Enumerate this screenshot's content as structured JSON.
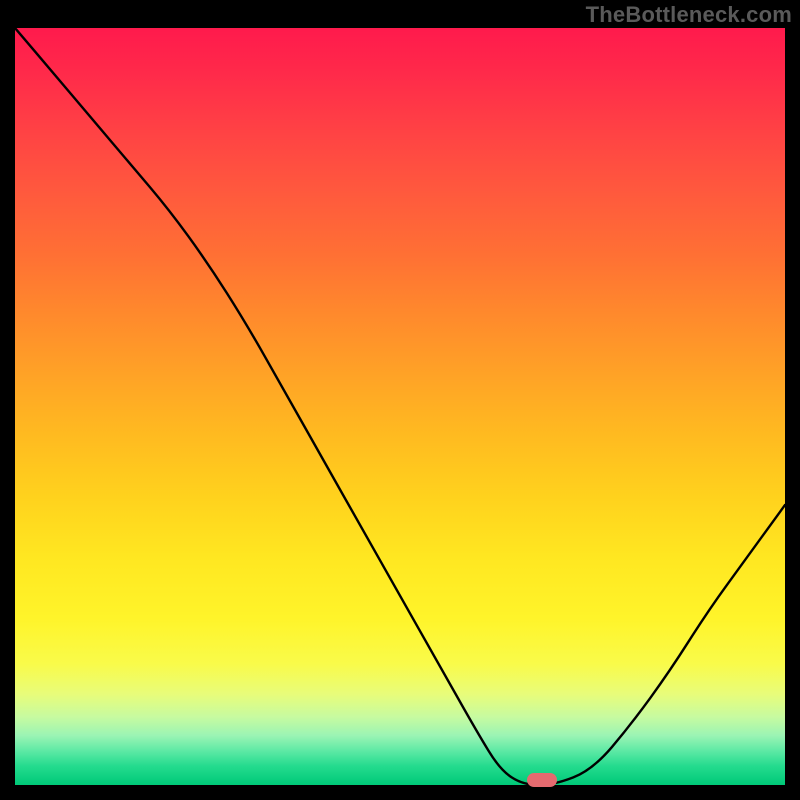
{
  "watermark": "TheBottleneck.com",
  "chart_data": {
    "type": "line",
    "title": "",
    "xlabel": "",
    "ylabel": "",
    "x": [
      0.0,
      0.05,
      0.1,
      0.15,
      0.2,
      0.25,
      0.3,
      0.35,
      0.4,
      0.45,
      0.5,
      0.55,
      0.6,
      0.63,
      0.66,
      0.7,
      0.75,
      0.8,
      0.85,
      0.9,
      0.95,
      1.0
    ],
    "values": [
      1.0,
      0.94,
      0.88,
      0.82,
      0.76,
      0.69,
      0.61,
      0.52,
      0.43,
      0.34,
      0.25,
      0.16,
      0.07,
      0.02,
      0.0,
      0.0,
      0.02,
      0.08,
      0.15,
      0.23,
      0.3,
      0.37
    ],
    "xlim": [
      0,
      1
    ],
    "ylim": [
      0,
      1
    ],
    "marker": {
      "x": 0.685,
      "y": 0.0
    },
    "background": "red-yellow-green vertical gradient",
    "annotations": [
      "TheBottleneck.com"
    ]
  },
  "colors": {
    "curve": "#000000",
    "marker": "#e46a6f",
    "frame": "#000000"
  }
}
